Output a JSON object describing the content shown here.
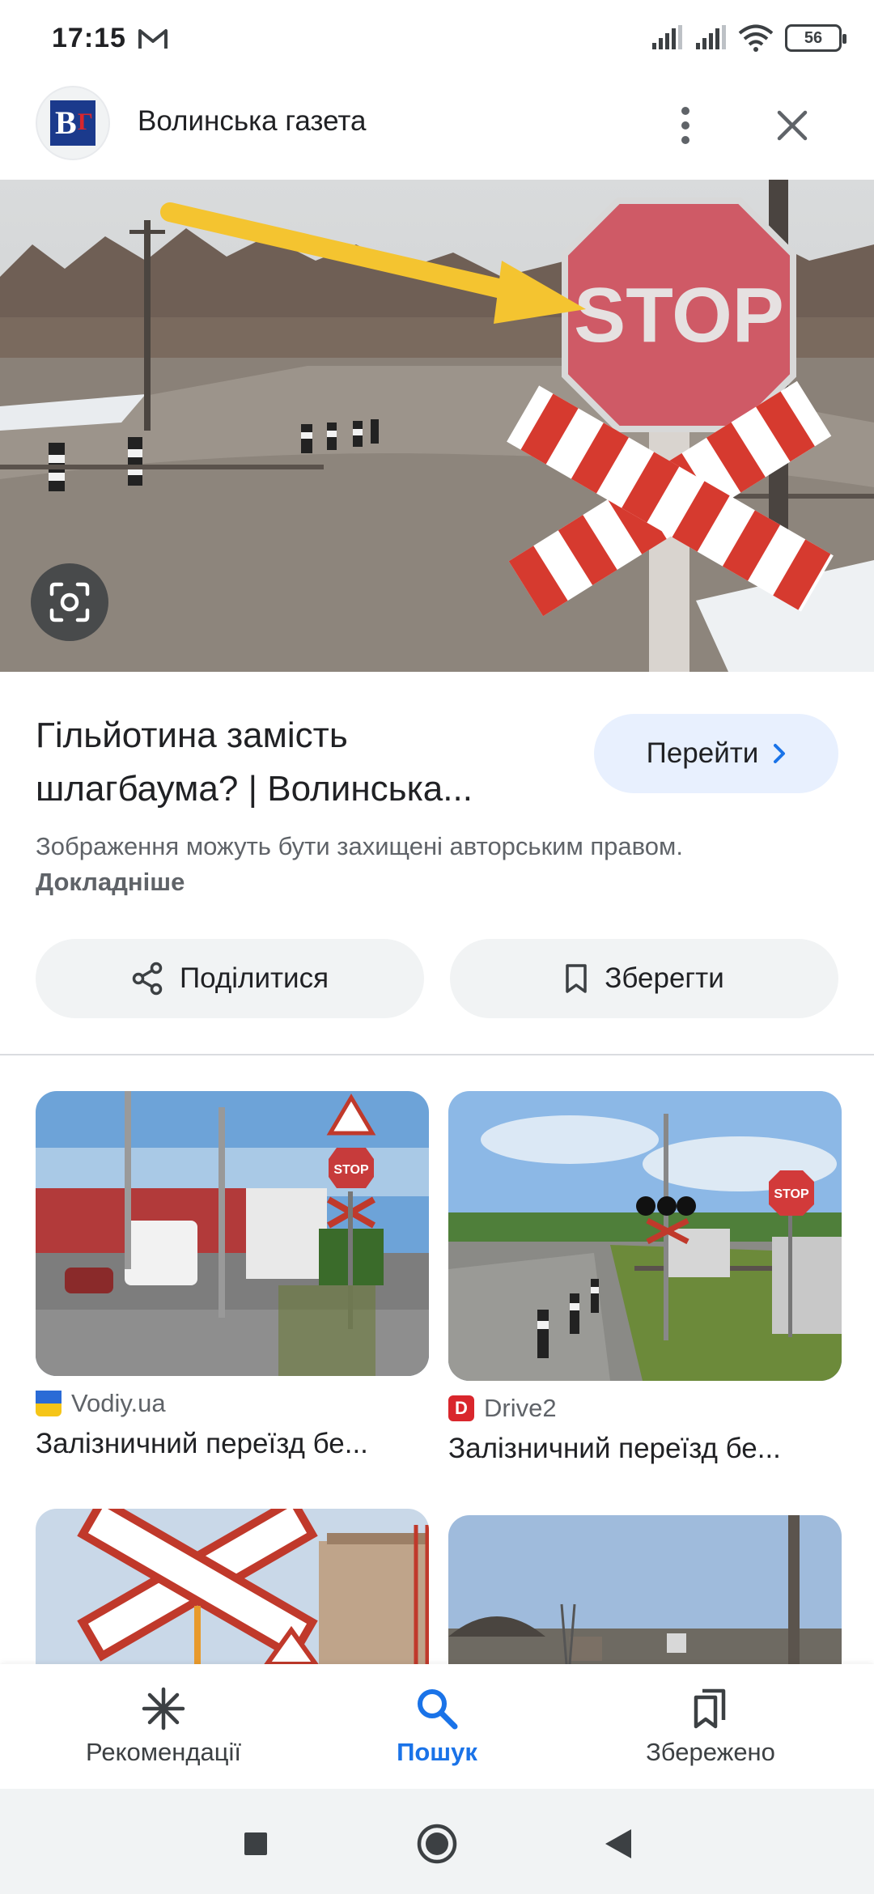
{
  "status_bar": {
    "time": "17:15",
    "battery": "56"
  },
  "header": {
    "site_name": "Волинська газета",
    "logo_letters": "ВГ"
  },
  "result": {
    "title": "Гільйотина замість шлагбаума? | Волинська...",
    "visit_label": "Перейти",
    "copyright_text": "Зображення можуть бути захищені авторським правом.",
    "learn_more": "Докладніше",
    "share_label": "Поділитися",
    "save_label": "Зберегти"
  },
  "related": [
    {
      "source": "Vodiy.ua",
      "title": "Залізничний переїзд бе...",
      "favicon_color": "#f5c518"
    },
    {
      "source": "Drive2",
      "title": "Залізничний переїзд бе...",
      "favicon_color": "#d9262c",
      "favicon_letter": "D"
    }
  ],
  "bottom_nav": {
    "items": [
      {
        "label": "Рекомендації",
        "icon": "asterisk-icon"
      },
      {
        "label": "Пошук",
        "icon": "search-icon",
        "active": true
      },
      {
        "label": "Збережено",
        "icon": "bookmarks-icon"
      }
    ]
  },
  "colors": {
    "accent": "#1a73e8",
    "visit_button_bg": "#e8f0fe",
    "chip_bg": "#f1f3f4"
  }
}
